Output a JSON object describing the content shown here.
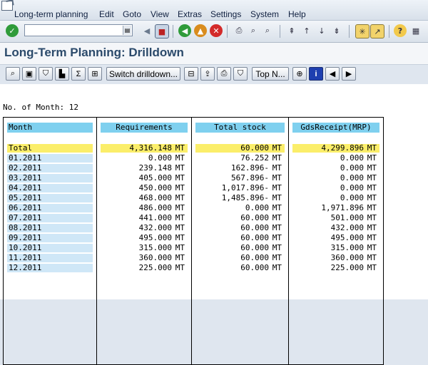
{
  "menubar": {
    "items": [
      "Long-term planning",
      "Edit",
      "Goto",
      "View",
      "Extras",
      "Settings",
      "System",
      "Help"
    ]
  },
  "toolbar": {
    "command_value": "",
    "icons": [
      "enter-icon",
      "save-icon",
      "back-icon",
      "exit-icon",
      "cancel-icon",
      "print-icon",
      "find-icon",
      "find-next-icon",
      "first-page-icon",
      "previous-page-icon",
      "next-page-icon",
      "last-page-icon",
      "create-session-icon",
      "shortcut-icon",
      "help-icon",
      "customize-layout-icon"
    ]
  },
  "title": "Long-Term Planning: Drilldown",
  "app_toolbar": {
    "switch_drilldown": "Switch drilldown...",
    "top_n": "Top N..."
  },
  "list": {
    "no_of_month_label": "No. of Month: 12",
    "headers": {
      "month": "Month",
      "requirements": "Requirements",
      "total_stock": "Total stock",
      "gds_receipt": "GdsReceipt(MRP)"
    },
    "unit": "MT",
    "rows": [
      {
        "month": "Total",
        "req": "4,316.148",
        "stock": "60.000",
        "gr": "4,299.896"
      },
      {
        "month": "01.2011",
        "req": "0.000",
        "stock": "76.252",
        "gr": "0.000"
      },
      {
        "month": "02.2011",
        "req": "239.148",
        "stock": "162.896-",
        "gr": "0.000"
      },
      {
        "month": "03.2011",
        "req": "405.000",
        "stock": "567.896-",
        "gr": "0.000"
      },
      {
        "month": "04.2011",
        "req": "450.000",
        "stock": "1,017.896-",
        "gr": "0.000"
      },
      {
        "month": "05.2011",
        "req": "468.000",
        "stock": "1,485.896-",
        "gr": "0.000"
      },
      {
        "month": "06.2011",
        "req": "486.000",
        "stock": "0.000",
        "gr": "1,971.896"
      },
      {
        "month": "07.2011",
        "req": "441.000",
        "stock": "60.000",
        "gr": "501.000"
      },
      {
        "month": "08.2011",
        "req": "432.000",
        "stock": "60.000",
        "gr": "432.000"
      },
      {
        "month": "09.2011",
        "req": "495.000",
        "stock": "60.000",
        "gr": "495.000"
      },
      {
        "month": "10.2011",
        "req": "315.000",
        "stock": "60.000",
        "gr": "315.000"
      },
      {
        "month": "11.2011",
        "req": "360.000",
        "stock": "60.000",
        "gr": "360.000"
      },
      {
        "month": "12.2011",
        "req": "225.000",
        "stock": "60.000",
        "gr": "225.000"
      }
    ]
  },
  "colors": {
    "header_cyan": "#7fd0ef",
    "total_yellow": "#fbee6a",
    "month_blue": "#cfe7f7",
    "title_blue": "#2b4a6b"
  }
}
